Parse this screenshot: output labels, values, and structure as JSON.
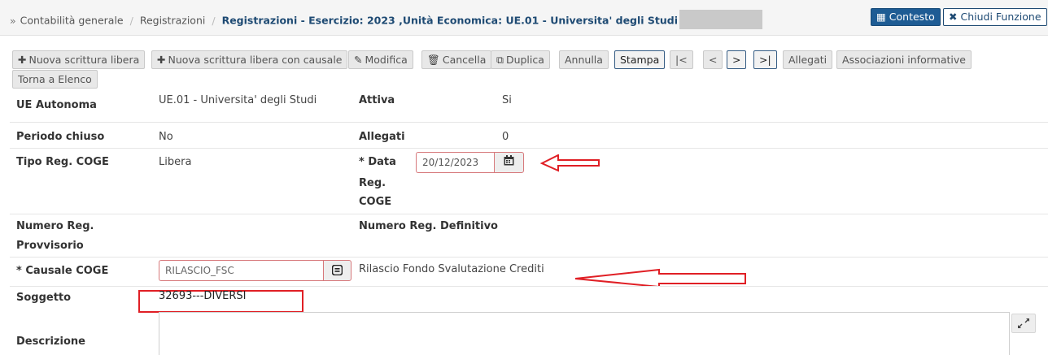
{
  "breadcrumb": {
    "root": "Contabilità generale",
    "section": "Registrazioni",
    "current": "Registrazioni - Esercizio: 2023 ,Unità Economica: UE.01 - Universita' degli Studi"
  },
  "header_buttons": {
    "contesto": "Contesto",
    "chiudi": "Chiudi Funzione"
  },
  "toolbar": {
    "nuova_libera": "Nuova scrittura libera",
    "nuova_causale": "Nuova scrittura libera con causale",
    "modifica": "Modifica",
    "cancella": "Cancella",
    "duplica": "Duplica",
    "annulla": "Annulla",
    "stampa": "Stampa",
    "first": "|<",
    "prev": "<",
    "next": ">",
    "last": ">|",
    "allegati": "Allegati",
    "associazioni": "Associazioni informative",
    "torna": "Torna a Elenco"
  },
  "form": {
    "ue_autonoma": {
      "label": "UE Autonoma",
      "value": "UE.01 - Universita' degli Studi"
    },
    "attiva": {
      "label": "Attiva",
      "value": "Si"
    },
    "periodo_chiuso": {
      "label": "Periodo chiuso",
      "value": "No"
    },
    "allegati": {
      "label": "Allegati",
      "value": "0"
    },
    "tipo_reg": {
      "label": "Tipo Reg. COGE",
      "value": "Libera"
    },
    "data_reg": {
      "label_1": "* Data",
      "label_2": "Reg.",
      "label_3": "COGE",
      "value": "20/12/2023"
    },
    "numero_prov": {
      "label_1": "Numero Reg.",
      "label_2": "Provvisorio"
    },
    "numero_def": {
      "label": "Numero Reg. Definitivo"
    },
    "causale": {
      "label": "* Causale COGE",
      "value": "RILASCIO_FSC",
      "description": "Rilascio Fondo Svalutazione Crediti"
    },
    "soggetto": {
      "label": "Soggetto",
      "value": "32693---DIVERSI"
    },
    "descrizione": {
      "label": "Descrizione",
      "value": ""
    }
  },
  "colors": {
    "annotation_red": "#e01f25",
    "primary_blue": "#1e5c94",
    "title_blue": "#1e4a73"
  }
}
